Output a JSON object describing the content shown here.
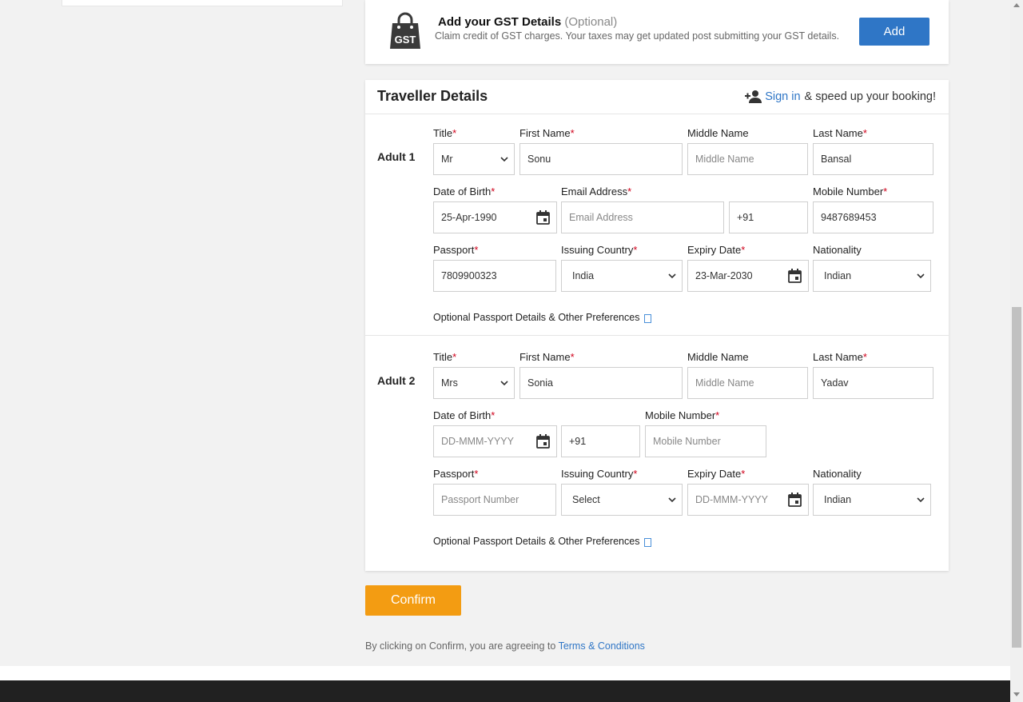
{
  "gst": {
    "title": "Add your GST Details",
    "optional": "(Optional)",
    "description": "Claim credit of GST charges. Your taxes may get updated post submitting your GST details.",
    "add_label": "Add",
    "icon": "gst-bag-icon",
    "icon_text": "GST"
  },
  "traveller": {
    "title": "Traveller Details",
    "signin_link": "Sign in",
    "signin_rest": "& speed up your booking!",
    "labels": {
      "title": "Title",
      "first_name": "First Name",
      "middle_name": "Middle Name",
      "last_name": "Last Name",
      "dob": "Date of Birth",
      "email": "Email Address",
      "mobile": "Mobile Number",
      "passport": "Passport",
      "issuing_country": "Issuing Country",
      "expiry": "Expiry Date",
      "nationality": "Nationality",
      "required_mark": "*"
    },
    "optional_prefs": "Optional Passport Details & Other Preferences",
    "adults": [
      {
        "label": "Adult 1",
        "title": "Mr",
        "first_name": "Sonu",
        "middle_name_placeholder": "Middle Name",
        "last_name": "Bansal",
        "dob": "25-Apr-1990",
        "email_placeholder": "Email Address",
        "country_code": "+91",
        "mobile": "9487689453",
        "passport": "7809900323",
        "issuing_country": "India",
        "expiry": "23-Mar-2030",
        "nationality": "Indian"
      },
      {
        "label": "Adult 2",
        "title": "Mrs",
        "first_name": "Sonia",
        "middle_name_placeholder": "Middle Name",
        "last_name": "Yadav",
        "dob_placeholder": "DD-MMM-YYYY",
        "country_code": "+91",
        "mobile_placeholder": "Mobile Number",
        "passport_placeholder": "Passport Number",
        "issuing_country": "Select",
        "expiry_placeholder": "DD-MMM-YYYY",
        "nationality": "Indian"
      }
    ]
  },
  "confirm_label": "Confirm",
  "terms": {
    "text": "By clicking on Confirm, you are agreeing to",
    "link": "Terms & Conditions"
  },
  "colors": {
    "accent_blue": "#2f76c6",
    "confirm_orange": "#f39c12",
    "required_red": "#d0021b",
    "footer": "#212121"
  }
}
